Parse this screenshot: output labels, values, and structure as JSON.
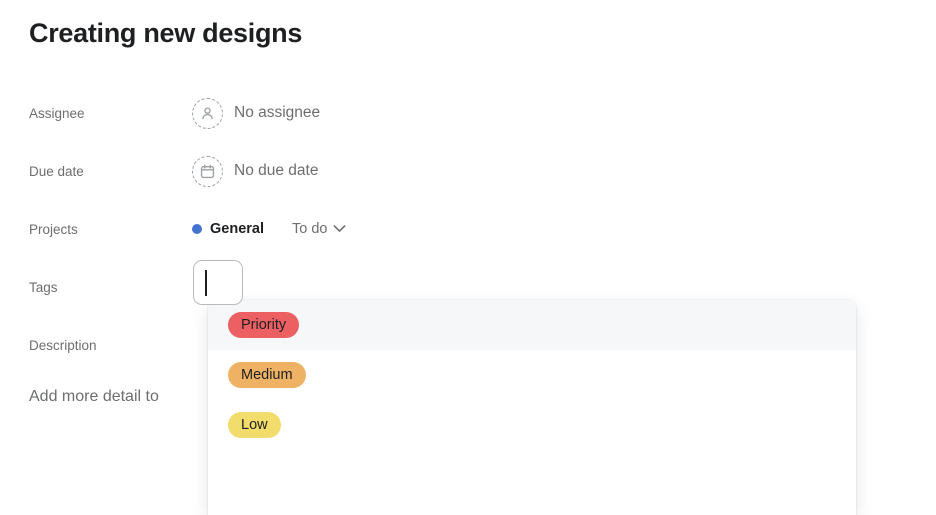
{
  "task": {
    "title": "Creating new designs"
  },
  "fields": {
    "assignee": {
      "label": "Assignee",
      "value": "No assignee",
      "icon": "person-placeholder-icon"
    },
    "due_date": {
      "label": "Due date",
      "value": "No due date",
      "icon": "calendar-placeholder-icon"
    },
    "projects": {
      "label": "Projects",
      "project_name": "General",
      "project_color": "#4573d2",
      "status": "To do",
      "chevron_icon": "chevron-down-icon"
    },
    "tags": {
      "label": "Tags",
      "input_value": "",
      "placeholder": ""
    },
    "description": {
      "label": "Description",
      "placeholder": "Add more detail to"
    }
  },
  "tags_dropdown": {
    "options": [
      {
        "label": "Priority",
        "color": "#ec5f63",
        "hovered": true
      },
      {
        "label": "Medium",
        "color": "#efb265",
        "hovered": false
      },
      {
        "label": "Low",
        "color": "#f2dc6b",
        "hovered": false
      }
    ]
  }
}
